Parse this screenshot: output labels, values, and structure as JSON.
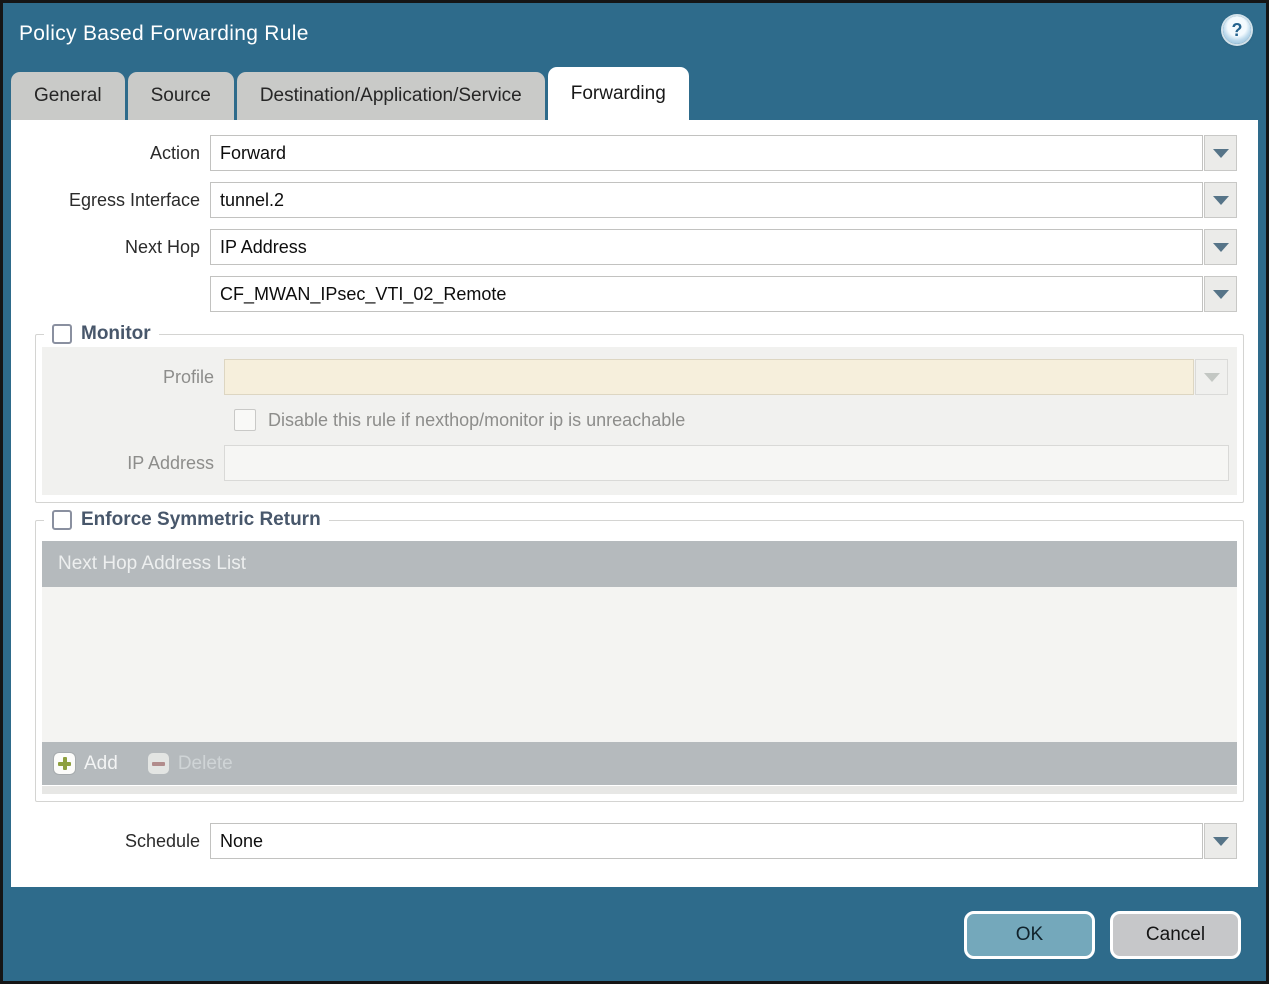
{
  "window": {
    "title": "Policy Based Forwarding Rule",
    "help_glyph": "?"
  },
  "tabs": [
    {
      "label": "General",
      "active": false
    },
    {
      "label": "Source",
      "active": false
    },
    {
      "label": "Destination/Application/Service",
      "active": false
    },
    {
      "label": "Forwarding",
      "active": true
    }
  ],
  "form": {
    "action": {
      "label": "Action",
      "value": "Forward"
    },
    "egress_interface": {
      "label": "Egress Interface",
      "value": "tunnel.2"
    },
    "next_hop": {
      "label": "Next Hop",
      "value": "IP Address"
    },
    "next_hop_address": {
      "value": "CF_MWAN_IPsec_VTI_02_Remote"
    },
    "schedule": {
      "label": "Schedule",
      "value": "None"
    }
  },
  "monitor": {
    "title": "Monitor",
    "checkbox_checked": false,
    "profile": {
      "label": "Profile",
      "value": ""
    },
    "disable_rule": {
      "label": "Disable this rule if nexthop/monitor ip is unreachable",
      "checked": false
    },
    "ip_address": {
      "label": "IP Address",
      "value": ""
    }
  },
  "enforce_symmetric_return": {
    "title": "Enforce Symmetric Return",
    "checkbox_checked": false,
    "table": {
      "header": "Next Hop Address List",
      "rows": []
    },
    "buttons": {
      "add": "Add",
      "delete": "Delete"
    }
  },
  "footer": {
    "ok": "OK",
    "cancel": "Cancel"
  },
  "colors": {
    "titlebar_teal": "#2e6b8b",
    "ok_button": "#74a8bb",
    "cancel_button": "#c6c7c9",
    "table_header_gray": "#b5babd",
    "disabled_field_tan": "#f6efdc",
    "add_icon_green": "#8ea03e",
    "delete_icon_red": "#b18c8c",
    "section_title": "#48576b"
  }
}
